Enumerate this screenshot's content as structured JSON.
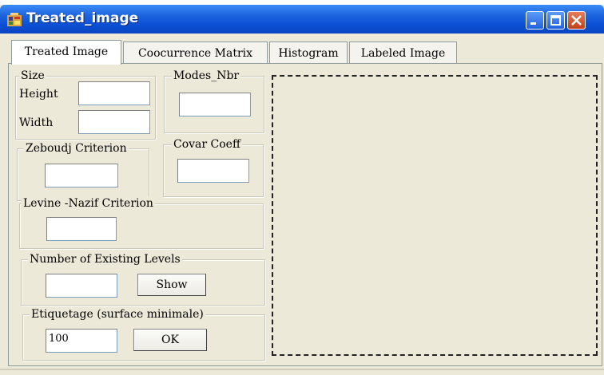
{
  "window": {
    "title": "Treated_image",
    "controls": [
      "minimize",
      "maximize",
      "close"
    ]
  },
  "tabs": [
    {
      "label": "Treated Image",
      "active": true
    },
    {
      "label": "Coocurrence Matrix",
      "active": false
    },
    {
      "label": "Histogram",
      "active": false
    },
    {
      "label": "Labeled Image",
      "active": false
    }
  ],
  "size_group": {
    "title": "Size",
    "height_label": "Height",
    "height_value": "",
    "width_label": "Width",
    "width_value": ""
  },
  "modes_group": {
    "title": "Modes_Nbr",
    "value": ""
  },
  "zeboudj_group": {
    "title": "Zeboudj Criterion",
    "value": ""
  },
  "covar_group": {
    "title": "Covar Coeff",
    "value": ""
  },
  "levine_group": {
    "title": "Levine -Nazif Criterion",
    "value": ""
  },
  "levels_group": {
    "title": "Number of Existing Levels",
    "value": "",
    "button_label": "Show"
  },
  "etiquetage_group": {
    "title": "Etiquetage (surface minimale)",
    "value": "100",
    "button_label": "OK"
  },
  "colors": {
    "titlebar": "#0a4fd4",
    "background": "#ece9d8"
  }
}
